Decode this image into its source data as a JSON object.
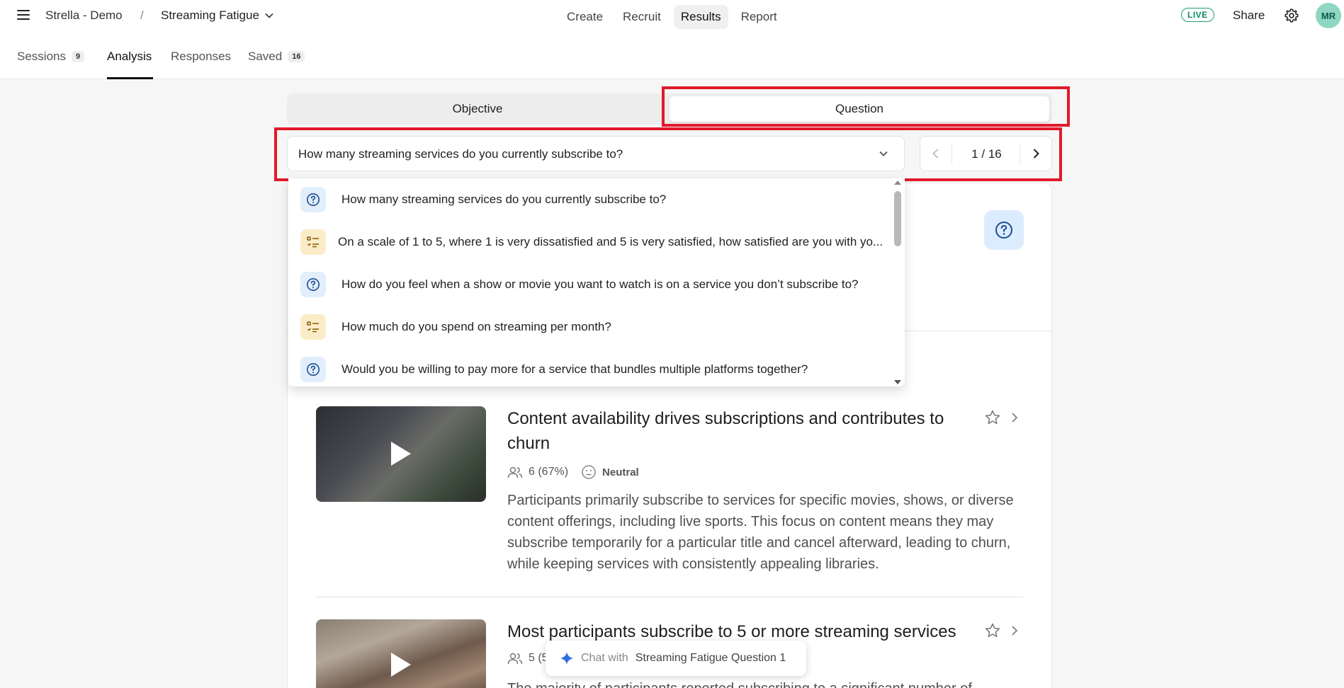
{
  "topbar": {
    "project": "Strella - Demo",
    "separator": "/",
    "study": "Streaming Fatigue",
    "nav": [
      "Create",
      "Recruit",
      "Results",
      "Report"
    ],
    "live": "LIVE",
    "share": "Share",
    "avatar": "MR"
  },
  "tabs": {
    "sessions": "Sessions",
    "sessions_count": "9",
    "analysis": "Analysis",
    "responses": "Responses",
    "saved": "Saved",
    "saved_count": "16"
  },
  "segmented": {
    "objective": "Objective",
    "question": "Question"
  },
  "question_select": {
    "selected": "How many streaming services do you currently subscribe to?",
    "page": "1 / 16"
  },
  "dropdown": {
    "items": [
      {
        "type": "question-icon",
        "text": "How many streaming services do you currently subscribe to?"
      },
      {
        "type": "list-icon",
        "text": "On a scale of 1 to 5, where 1 is very dissatisfied and 5 is very satisfied, how satisfied are you with yo..."
      },
      {
        "type": "question-icon",
        "text": "How do you feel when a show or movie you want to watch is on a service you don’t subscribe to?"
      },
      {
        "type": "list-icon",
        "text": "How much do you spend on streaming per month?"
      },
      {
        "type": "question-icon",
        "text": "Would you be willing to pay more for a service that bundles multiple platforms together?"
      }
    ]
  },
  "insights": [
    {
      "title": "Content availability drives subscriptions and contributes to churn",
      "participants": "6 (67%)",
      "sentiment": "Neutral",
      "body": "Participants primarily subscribe to services for specific movies, shows, or diverse content offerings, including live sports. This focus on content means they may subscribe temporarily for a particular title and cancel afterward, leading to churn, while keeping services with consistently appealing libraries."
    },
    {
      "title": "Most participants subscribe to 5 or more streaming services",
      "participants": "5 (5",
      "body": "The majority of participants reported subscribing to a significant number of"
    }
  ],
  "chat": {
    "prefix": "Chat with",
    "target": "Streaming Fatigue Question 1"
  },
  "colors": {
    "highlight": "#e01a2a",
    "live": "#19a06d",
    "avatar": "#8fd6c4"
  }
}
